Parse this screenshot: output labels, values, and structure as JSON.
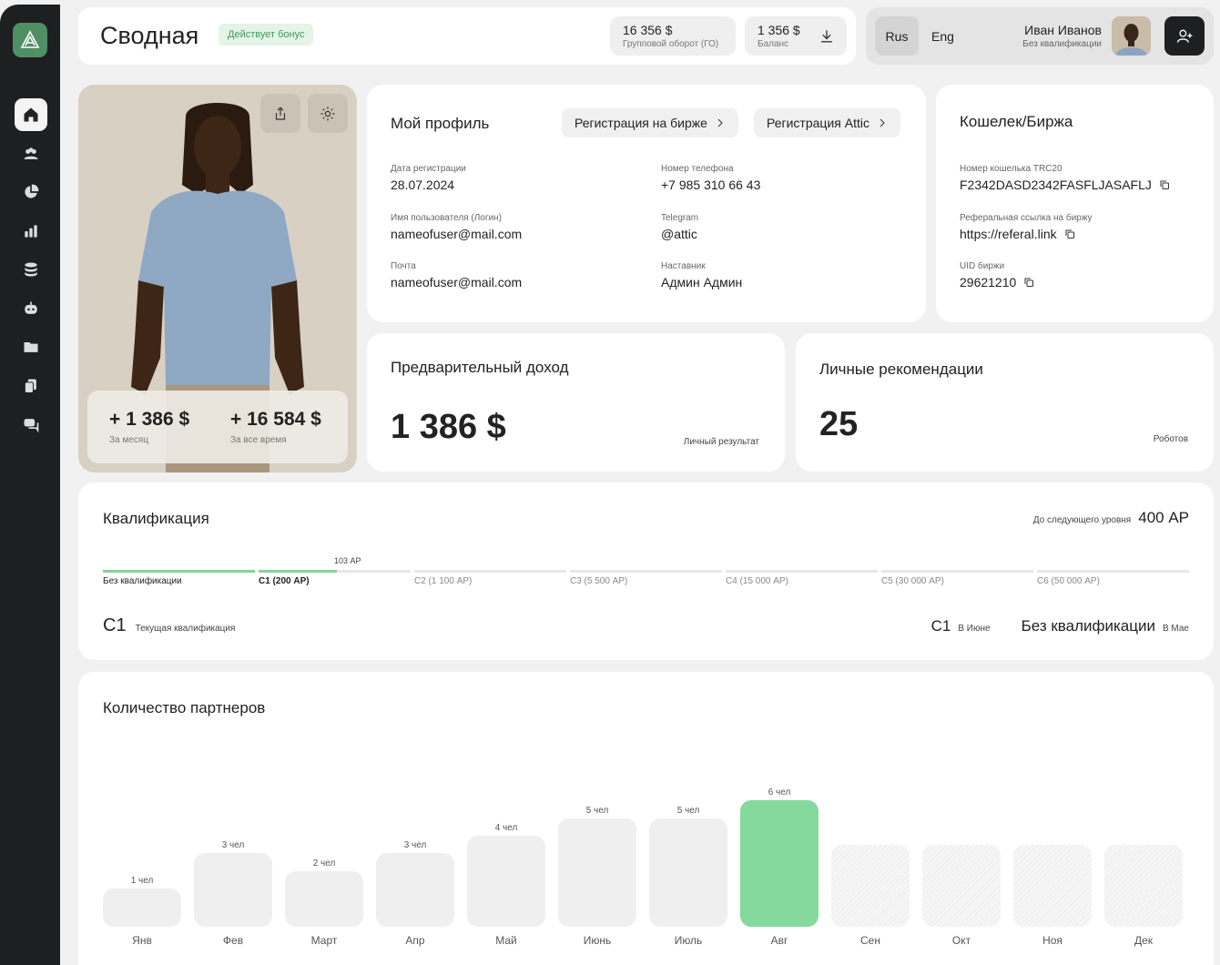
{
  "header": {
    "title": "Сводная",
    "bonus_badge": "Действует бонус",
    "group_turnover": {
      "value": "16 356 $",
      "label": "Групповой оборот (ГО)"
    },
    "balance": {
      "value": "1 356 $",
      "label": "Баланс"
    }
  },
  "lang": {
    "rus": "Rus",
    "eng": "Eng"
  },
  "user": {
    "name": "Иван Иванов",
    "status": "Без квалификации"
  },
  "photo_card": {
    "month_value": "+ 1 386 $",
    "month_label": "За месяц",
    "total_value": "+ 16 584 $",
    "total_label": "За все время"
  },
  "profile": {
    "title": "Мой профиль",
    "btn_exchange": "Регистрация на бирже",
    "btn_attic": "Регистрация Attic",
    "fields": [
      {
        "label": "Дата регистрации",
        "value": "28.07.2024"
      },
      {
        "label": "Номер телефона",
        "value": "+7 985 310 66 43"
      },
      {
        "label": "Имя пользователя (Логин)",
        "value": "nameofuser@mail.com"
      },
      {
        "label": "Telegram",
        "value": "@attic"
      },
      {
        "label": "Почта",
        "value": "nameofuser@mail.com"
      },
      {
        "label": "Наставник",
        "value": "Админ Админ"
      }
    ]
  },
  "wallet": {
    "title": "Кошелек/Биржа",
    "fields": [
      {
        "label": "Номер кошелька TRC20",
        "value": "F2342DASD2342FASFLJASAFLJ"
      },
      {
        "label": "Реферальная ссылка на биржу",
        "value": "https://referal.link"
      },
      {
        "label": "UID биржи",
        "value": "29621210"
      }
    ]
  },
  "income": {
    "title": "Предварительный доход",
    "value": "1 386 $",
    "note": "Личный результат"
  },
  "recommend": {
    "title": "Личные рекомендации",
    "value": "25",
    "note": "Роботов"
  },
  "qualification": {
    "title": "Квалификация",
    "next_label": "До следующего уровня",
    "next_value": "400 АР",
    "marker": "103 АР",
    "progress": 0.515,
    "levels": [
      "Без квалификации",
      "C1 (200 АР)",
      "C2 (1 100 АР)",
      "C3 (5 500 АР)",
      "C4 (15 000 АР)",
      "C5 (30 000 АР)",
      "C6 (50 000 АР)"
    ],
    "current_code": "C1",
    "current_label": "Текущая квалификация",
    "june_code": "C1",
    "june_label": "В Июне",
    "may_code": "Без квалификации",
    "may_label": "В Мае"
  },
  "partners": {
    "title": "Количество партнеров",
    "unit": "чел",
    "months": [
      "Янв",
      "Фев",
      "Март",
      "Апр",
      "Май",
      "Июнь",
      "Июль",
      "Авг",
      "Сен",
      "Окт",
      "Ноя",
      "Дек"
    ],
    "values": [
      1,
      3,
      2,
      3,
      4,
      5,
      5,
      6,
      null,
      null,
      null,
      null
    ],
    "value_labels": [
      "1 чел",
      "3 чел",
      "2 чел",
      "3 чел",
      "4 чел",
      "5 чел",
      "5 чел",
      "6 чел",
      "",
      "",
      "",
      ""
    ],
    "highlight_index": 7,
    "highlight_color": "#86d99c"
  }
}
